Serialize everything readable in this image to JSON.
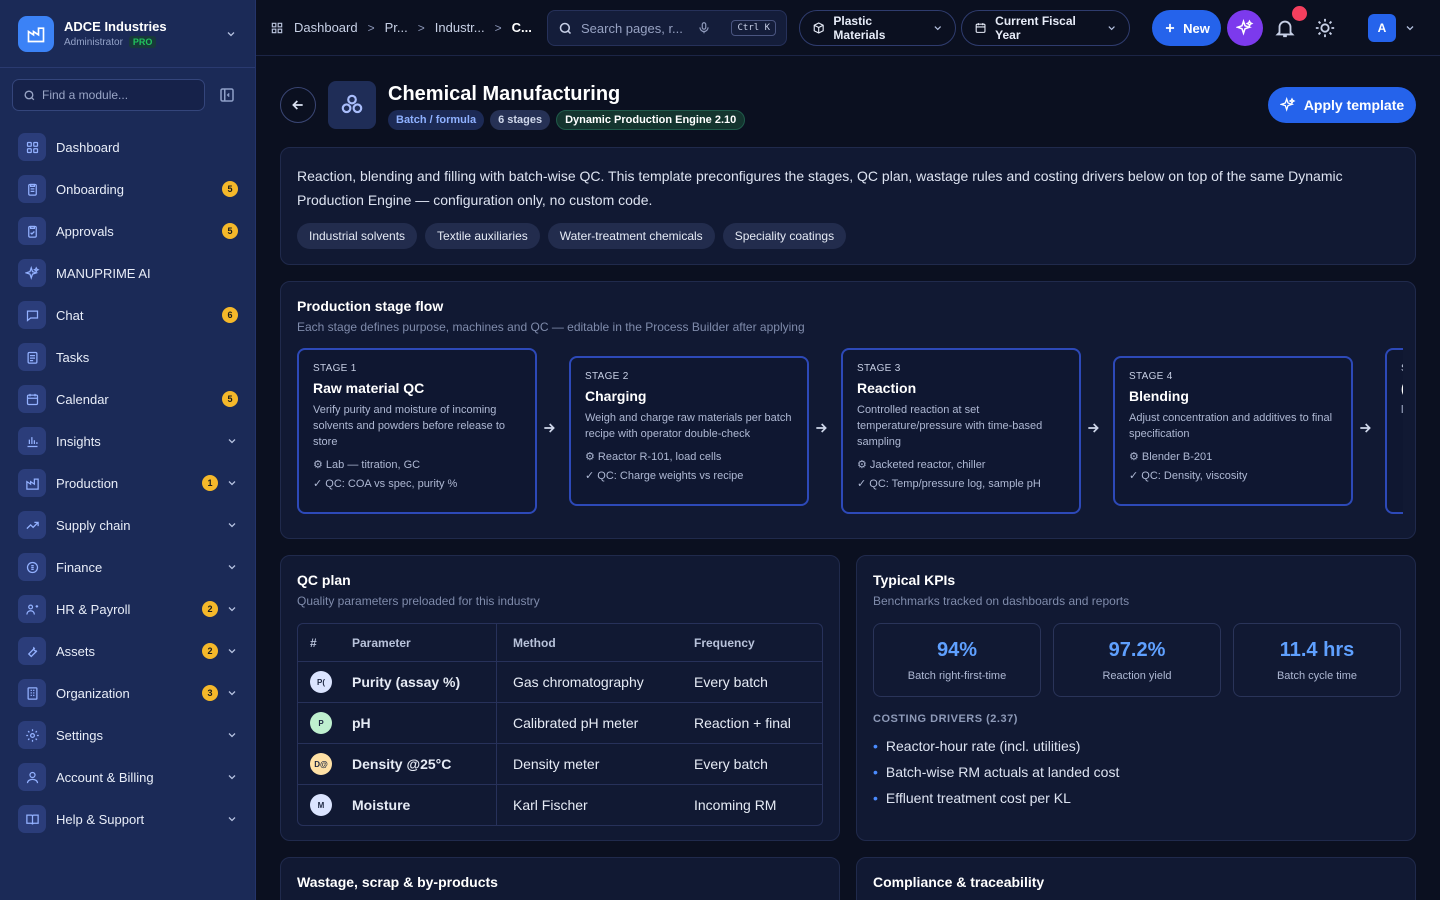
{
  "brand": {
    "name": "ADCE Industries",
    "role": "Administrator",
    "tier": "PRO"
  },
  "sidebar": {
    "find_placeholder": "Find a module...",
    "items": [
      {
        "label": "Dashboard",
        "icon": "grid-icon",
        "badge": "",
        "expand": false
      },
      {
        "label": "Onboarding",
        "icon": "clipboard-icon",
        "badge": "5",
        "expand": false
      },
      {
        "label": "Approvals",
        "icon": "check-clipboard-icon",
        "badge": "5",
        "expand": false
      },
      {
        "label": "MANUPRIME AI",
        "icon": "sparkle-icon",
        "badge": "",
        "expand": false
      },
      {
        "label": "Chat",
        "icon": "chat-icon",
        "badge": "6",
        "expand": false
      },
      {
        "label": "Tasks",
        "icon": "tasks-icon",
        "badge": "",
        "expand": false
      },
      {
        "label": "Calendar",
        "icon": "calendar-icon",
        "badge": "5",
        "expand": false
      },
      {
        "label": "Insights",
        "icon": "bar-chart-icon",
        "badge": "",
        "expand": true
      },
      {
        "label": "Production",
        "icon": "factory-icon",
        "badge": "1",
        "expand": true
      },
      {
        "label": "Supply chain",
        "icon": "trend-icon",
        "badge": "",
        "expand": true
      },
      {
        "label": "Finance",
        "icon": "coin-icon",
        "badge": "",
        "expand": true
      },
      {
        "label": "HR & Payroll",
        "icon": "users-icon",
        "badge": "2",
        "expand": true
      },
      {
        "label": "Assets",
        "icon": "wrench-icon",
        "badge": "2",
        "expand": true
      },
      {
        "label": "Organization",
        "icon": "building-icon",
        "badge": "3",
        "expand": true
      },
      {
        "label": "Settings",
        "icon": "gear-icon",
        "badge": "",
        "expand": true
      },
      {
        "label": "Account & Billing",
        "icon": "user-icon",
        "badge": "",
        "expand": true
      },
      {
        "label": "Help & Support",
        "icon": "book-icon",
        "badge": "",
        "expand": true
      }
    ]
  },
  "topbar": {
    "breadcrumbs": [
      "Dashboard",
      "Pr...",
      "Industr...",
      "C..."
    ],
    "search_placeholder": "Search pages, r...",
    "shortcut": "Ctrl K",
    "material_select": "Plastic Materials",
    "period_select": "Current Fiscal Year",
    "new_label": "New",
    "avatar_initial": "A"
  },
  "header": {
    "title": "Chemical Manufacturing",
    "tags": [
      "Batch / formula",
      "6 stages",
      "Dynamic Production Engine 2.10"
    ],
    "apply_label": "Apply template"
  },
  "description": {
    "text": "Reaction, blending and filling with batch-wise QC. This template preconfigures the stages, QC plan, wastage rules and costing drivers below on top of the same Dynamic Production Engine — configuration only, no custom code.",
    "chips": [
      "Industrial solvents",
      "Textile auxiliaries",
      "Water-treatment chemicals",
      "Speciality coatings"
    ]
  },
  "flow": {
    "title": "Production stage flow",
    "subtitle": "Each stage defines purpose, machines and QC — editable in the Process Builder after applying",
    "stages": [
      {
        "num": "STAGE 1",
        "name": "Raw material QC",
        "desc": "Verify purity and moisture of incoming solvents and powders before release to store",
        "machines": "⚙ Lab — titration, GC",
        "qc": "✓ QC: COA vs spec, purity %"
      },
      {
        "num": "STAGE 2",
        "name": "Charging",
        "desc": "Weigh and charge raw materials per batch recipe with operator double-check",
        "machines": "⚙ Reactor R-101, load cells",
        "qc": "✓ QC: Charge weights vs recipe"
      },
      {
        "num": "STAGE 3",
        "name": "Reaction",
        "desc": "Controlled reaction at set temperature/pressure with time-based sampling",
        "machines": "⚙ Jacketed reactor, chiller",
        "qc": "✓ QC: Temp/pressure log, sample pH"
      },
      {
        "num": "STAGE 4",
        "name": "Blending",
        "desc": "Adjust concentration and additives to final specification",
        "machines": "⚙ Blender B-201",
        "qc": "✓ QC: Density, viscosity"
      },
      {
        "num": "S",
        "name": "(",
        "desc": "l",
        "machines": "",
        "qc": ""
      }
    ]
  },
  "qc_plan": {
    "title": "QC plan",
    "subtitle": "Quality parameters preloaded for this industry",
    "headers": [
      "#",
      "Parameter",
      "Method",
      "Frequency"
    ],
    "rows": [
      {
        "badge": "P(",
        "badge_color": "#dbe4ff",
        "param": "Purity (assay %)",
        "method": "Gas chromatography",
        "freq": "Every batch"
      },
      {
        "badge": "P",
        "badge_color": "#bff0cf",
        "param": "pH",
        "method": "Calibrated pH meter",
        "freq": "Reaction + final"
      },
      {
        "badge": "D@",
        "badge_color": "#ffe1a6",
        "param": "Density @25°C",
        "method": "Density meter",
        "freq": "Every batch"
      },
      {
        "badge": "M",
        "badge_color": "#dbe4ff",
        "param": "Moisture",
        "method": "Karl Fischer",
        "freq": "Incoming RM"
      }
    ]
  },
  "kpis": {
    "title": "Typical KPIs",
    "subtitle": "Benchmarks tracked on dashboards and reports",
    "items": [
      {
        "value": "94%",
        "label": "Batch right-first-time"
      },
      {
        "value": "97.2%",
        "label": "Reaction yield"
      },
      {
        "value": "11.4 hrs",
        "label": "Batch cycle time"
      }
    ],
    "drivers_title": "COSTING DRIVERS (2.37)",
    "drivers": [
      "Reactor-hour rate (incl. utilities)",
      "Batch-wise RM actuals at landed cost",
      "Effluent treatment cost per KL"
    ]
  },
  "wastage": {
    "title": "Wastage, scrap & by-products"
  },
  "compliance": {
    "title": "Compliance & traceability"
  }
}
